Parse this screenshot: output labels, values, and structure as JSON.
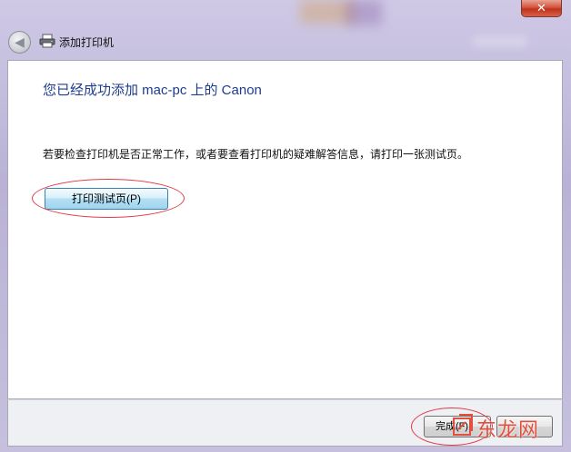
{
  "window": {
    "title": "添加打印机",
    "close_glyph": "✕"
  },
  "nav": {
    "back_glyph": "◀"
  },
  "content": {
    "heading": "您已经成功添加 mac-pc 上的 Canon",
    "description": "若要检查打印机是否正常工作，或者要查看打印机的疑难解答信息，请打印一张测试页。",
    "test_page_button": "打印测试页(P)"
  },
  "footer": {
    "finish_button": "完成(F)",
    "cancel_button": ""
  },
  "watermark": {
    "text": "东龙网"
  },
  "icons": {
    "back": "back-arrow-icon",
    "printer": "printer-icon",
    "close": "close-icon"
  },
  "colors": {
    "heading": "#1e3d8c",
    "annotation": "#e23a4a",
    "close_button": "#c0321a",
    "primary_button": "#9fd5ef"
  }
}
